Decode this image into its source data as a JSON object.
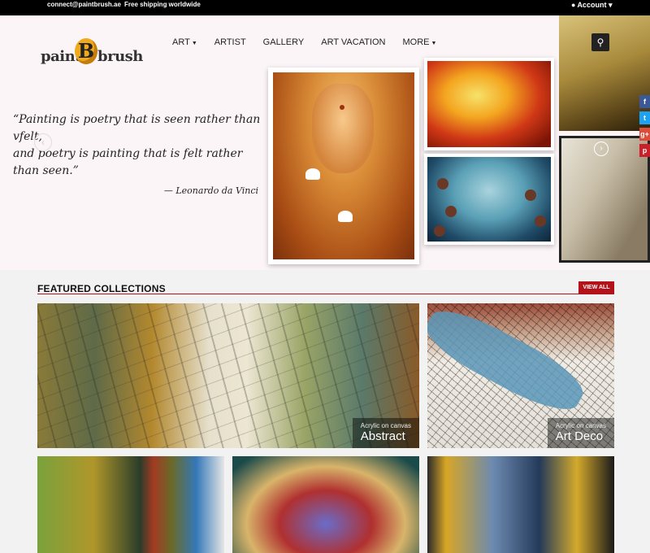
{
  "topbar": {
    "email": "connect@paintbrush.ae",
    "shipping": "Free shipping worldwide",
    "account_label": "Account"
  },
  "logo": {
    "left_text": "paint",
    "letter": "B",
    "right_text": "brush"
  },
  "nav": {
    "items": [
      {
        "label": "ART",
        "dropdown": true
      },
      {
        "label": "ARTIST",
        "dropdown": false
      },
      {
        "label": "GALLERY",
        "dropdown": false
      },
      {
        "label": "ART VACATION",
        "dropdown": false
      },
      {
        "label": "MORE",
        "dropdown": true
      }
    ]
  },
  "quote": {
    "line1": "“Painting is poetry that is seen rather than vfelt,",
    "line2": "and poetry is painting that is felt rather than seen.”",
    "author": "— Leonardo da Vinci"
  },
  "social": [
    "f",
    "t",
    "g+",
    "p"
  ],
  "featured": {
    "title": "FEATURED COLLECTIONS",
    "view_all": "VIEW ALL",
    "tiles": [
      {
        "sub": "Acrylic on canvas",
        "name": "Abstract"
      },
      {
        "sub": "Acrylic on canvas",
        "name": "Art Deco"
      }
    ]
  },
  "colors": {
    "accent": "#b3121a",
    "topbar": "#000000",
    "hero_bg": "#fcf5f7"
  }
}
